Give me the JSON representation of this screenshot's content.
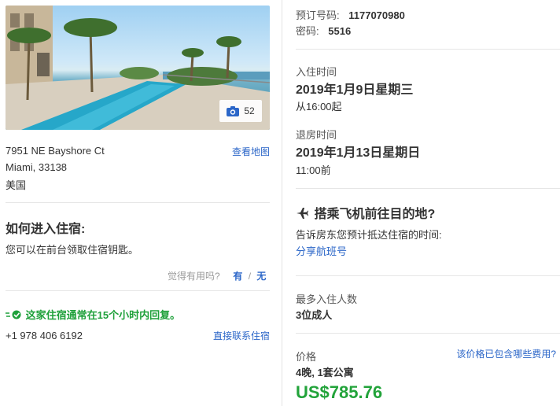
{
  "hero": {
    "photo_count": "52"
  },
  "address": {
    "line1": "7951 NE Bayshore Ct",
    "line2": "Miami, 33138",
    "country": "美国",
    "map_link": "查看地图"
  },
  "checkin_instructions": {
    "title": "如何进入住宿:",
    "body": "您可以在前台领取住宿钥匙。",
    "helpful_prompt": "觉得有用吗?",
    "yes": "有",
    "slash": "/",
    "no": "无"
  },
  "host": {
    "response_note": "这家住宿通常在15个小时内回复。",
    "phone": "+1 978 406 6192",
    "contact_link": "直接联系住宿"
  },
  "booking": {
    "ref_label": "预订号码:",
    "ref_value": "1177070980",
    "pin_label": "密码:",
    "pin_value": "5516"
  },
  "checkin": {
    "label": "入住时间",
    "date": "2019年1月9日星期三",
    "time": "从16:00起"
  },
  "checkout": {
    "label": "退房时间",
    "date": "2019年1月13日星期日",
    "time": "11:00前"
  },
  "flight": {
    "title": "搭乘飞机前往目的地?",
    "desc": "告诉房东您预计抵达住宿的时间:",
    "share_link": "分享航班号"
  },
  "guests": {
    "label": "最多入住人数",
    "value": "3位成人"
  },
  "price": {
    "label": "价格",
    "fees_link": "该价格已包含哪些费用?",
    "summary": "4晚, 1套公寓",
    "amount": "US$785.76"
  },
  "colors": {
    "link": "#2b66c8",
    "green": "#1ea03a",
    "price": "#22a33a"
  }
}
